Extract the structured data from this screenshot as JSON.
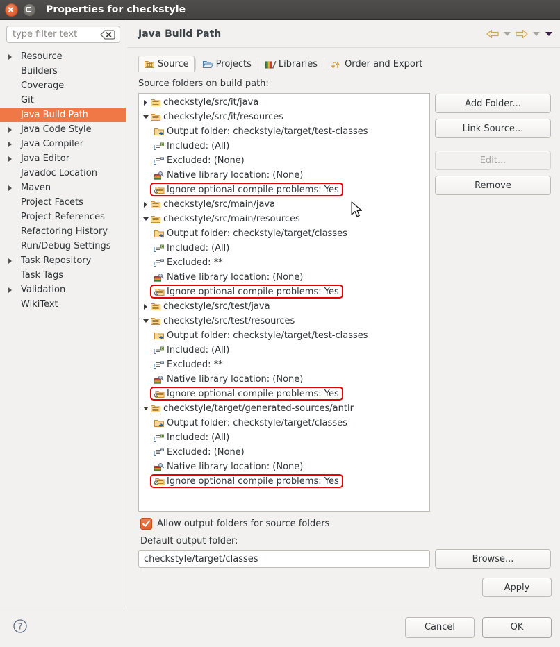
{
  "window": {
    "title": "Properties for checkstyle",
    "close_label": "Close",
    "maximize_label": "Maximize"
  },
  "sidebar": {
    "filter": {
      "value": "",
      "placeholder": "type filter text"
    },
    "items": [
      {
        "label": "Resource",
        "expandable": true,
        "selected": false
      },
      {
        "label": "Builders",
        "expandable": false,
        "selected": false
      },
      {
        "label": "Coverage",
        "expandable": false,
        "selected": false
      },
      {
        "label": "Git",
        "expandable": false,
        "selected": false
      },
      {
        "label": "Java Build Path",
        "expandable": false,
        "selected": true
      },
      {
        "label": "Java Code Style",
        "expandable": true,
        "selected": false
      },
      {
        "label": "Java Compiler",
        "expandable": true,
        "selected": false
      },
      {
        "label": "Java Editor",
        "expandable": true,
        "selected": false
      },
      {
        "label": "Javadoc Location",
        "expandable": false,
        "selected": false
      },
      {
        "label": "Maven",
        "expandable": true,
        "selected": false
      },
      {
        "label": "Project Facets",
        "expandable": false,
        "selected": false
      },
      {
        "label": "Project References",
        "expandable": false,
        "selected": false
      },
      {
        "label": "Refactoring History",
        "expandable": false,
        "selected": false
      },
      {
        "label": "Run/Debug Settings",
        "expandable": false,
        "selected": false
      },
      {
        "label": "Task Repository",
        "expandable": true,
        "selected": false
      },
      {
        "label": "Task Tags",
        "expandable": false,
        "selected": false
      },
      {
        "label": "Validation",
        "expandable": true,
        "selected": false
      },
      {
        "label": "WikiText",
        "expandable": false,
        "selected": false
      }
    ]
  },
  "pane": {
    "title": "Java Build Path",
    "nav": {
      "back_label": "Back",
      "forward_label": "Forward",
      "menu_label": "View Menu"
    },
    "tabs": [
      {
        "label": "Source",
        "icon": "source-folder-icon",
        "active": true
      },
      {
        "label": "Projects",
        "icon": "open-folder-icon",
        "active": false
      },
      {
        "label": "Libraries",
        "icon": "books-icon",
        "active": false
      },
      {
        "label": "Order and Export",
        "icon": "order-export-icon",
        "active": false
      }
    ],
    "subtitle": "Source folders on build path:",
    "buttons": [
      {
        "label": "Add Folder...",
        "enabled": true
      },
      {
        "label": "Link Source...",
        "enabled": true
      },
      {
        "label": "Edit...",
        "enabled": false
      },
      {
        "label": "Remove",
        "enabled": true
      }
    ],
    "allow_output_folders": {
      "label": "Allow output folders for source folders",
      "checked": true
    },
    "default_output_folder": {
      "label": "Default output folder:",
      "value": "checkstyle/target/classes"
    },
    "browse_label": "Browse...",
    "apply_label": "Apply"
  },
  "source_tree": [
    {
      "level": 0,
      "expander": "collapsed",
      "icon": "source-folder-icon",
      "text": "checkstyle/src/it/java",
      "highlight": false
    },
    {
      "level": 0,
      "expander": "expanded",
      "icon": "source-folder-icon",
      "text": "checkstyle/src/it/resources",
      "highlight": false
    },
    {
      "level": 1,
      "expander": "none",
      "icon": "output-folder-icon",
      "text": "Output folder: checkstyle/target/test-classes",
      "highlight": false
    },
    {
      "level": 1,
      "expander": "none",
      "icon": "included-icon",
      "text": "Included: (All)",
      "highlight": false
    },
    {
      "level": 1,
      "expander": "none",
      "icon": "excluded-icon",
      "text": "Excluded: (None)",
      "highlight": false
    },
    {
      "level": 1,
      "expander": "none",
      "icon": "native-library-icon",
      "text": "Native library location: (None)",
      "highlight": false
    },
    {
      "level": 1,
      "expander": "none",
      "icon": "ignore-problems-icon",
      "text": "Ignore optional compile problems: Yes",
      "highlight": true
    },
    {
      "level": 0,
      "expander": "collapsed",
      "icon": "source-folder-icon",
      "text": "checkstyle/src/main/java",
      "highlight": false
    },
    {
      "level": 0,
      "expander": "expanded",
      "icon": "source-folder-icon",
      "text": "checkstyle/src/main/resources",
      "highlight": false
    },
    {
      "level": 1,
      "expander": "none",
      "icon": "output-folder-icon",
      "text": "Output folder: checkstyle/target/classes",
      "highlight": false
    },
    {
      "level": 1,
      "expander": "none",
      "icon": "included-icon",
      "text": "Included: (All)",
      "highlight": false
    },
    {
      "level": 1,
      "expander": "none",
      "icon": "excluded-icon",
      "text": "Excluded: **",
      "highlight": false
    },
    {
      "level": 1,
      "expander": "none",
      "icon": "native-library-icon",
      "text": "Native library location: (None)",
      "highlight": false
    },
    {
      "level": 1,
      "expander": "none",
      "icon": "ignore-problems-icon",
      "text": "Ignore optional compile problems: Yes",
      "highlight": true
    },
    {
      "level": 0,
      "expander": "collapsed",
      "icon": "source-folder-icon",
      "text": "checkstyle/src/test/java",
      "highlight": false
    },
    {
      "level": 0,
      "expander": "expanded",
      "icon": "source-folder-icon",
      "text": "checkstyle/src/test/resources",
      "highlight": false
    },
    {
      "level": 1,
      "expander": "none",
      "icon": "output-folder-icon",
      "text": "Output folder: checkstyle/target/test-classes",
      "highlight": false
    },
    {
      "level": 1,
      "expander": "none",
      "icon": "included-icon",
      "text": "Included: (All)",
      "highlight": false
    },
    {
      "level": 1,
      "expander": "none",
      "icon": "excluded-icon",
      "text": "Excluded: **",
      "highlight": false
    },
    {
      "level": 1,
      "expander": "none",
      "icon": "native-library-icon",
      "text": "Native library location: (None)",
      "highlight": false
    },
    {
      "level": 1,
      "expander": "none",
      "icon": "ignore-problems-icon",
      "text": "Ignore optional compile problems: Yes",
      "highlight": true
    },
    {
      "level": 0,
      "expander": "expanded",
      "icon": "source-folder-icon",
      "text": "checkstyle/target/generated-sources/antlr",
      "highlight": false
    },
    {
      "level": 1,
      "expander": "none",
      "icon": "output-folder-icon",
      "text": "Output folder: checkstyle/target/classes",
      "highlight": false
    },
    {
      "level": 1,
      "expander": "none",
      "icon": "included-icon",
      "text": "Included: (All)",
      "highlight": false
    },
    {
      "level": 1,
      "expander": "none",
      "icon": "excluded-icon",
      "text": "Excluded: (None)",
      "highlight": false
    },
    {
      "level": 1,
      "expander": "none",
      "icon": "native-library-icon",
      "text": "Native library location: (None)",
      "highlight": false
    },
    {
      "level": 1,
      "expander": "none",
      "icon": "ignore-problems-icon",
      "text": "Ignore optional compile problems: Yes",
      "highlight": true
    }
  ],
  "footer": {
    "help_label": "Help",
    "cancel_label": "Cancel",
    "ok_label": "OK"
  },
  "colors": {
    "selection": "#f07746",
    "highlight_box": "#e60000",
    "titlebar": "#4a4846",
    "checkbox": "#e0622f"
  }
}
